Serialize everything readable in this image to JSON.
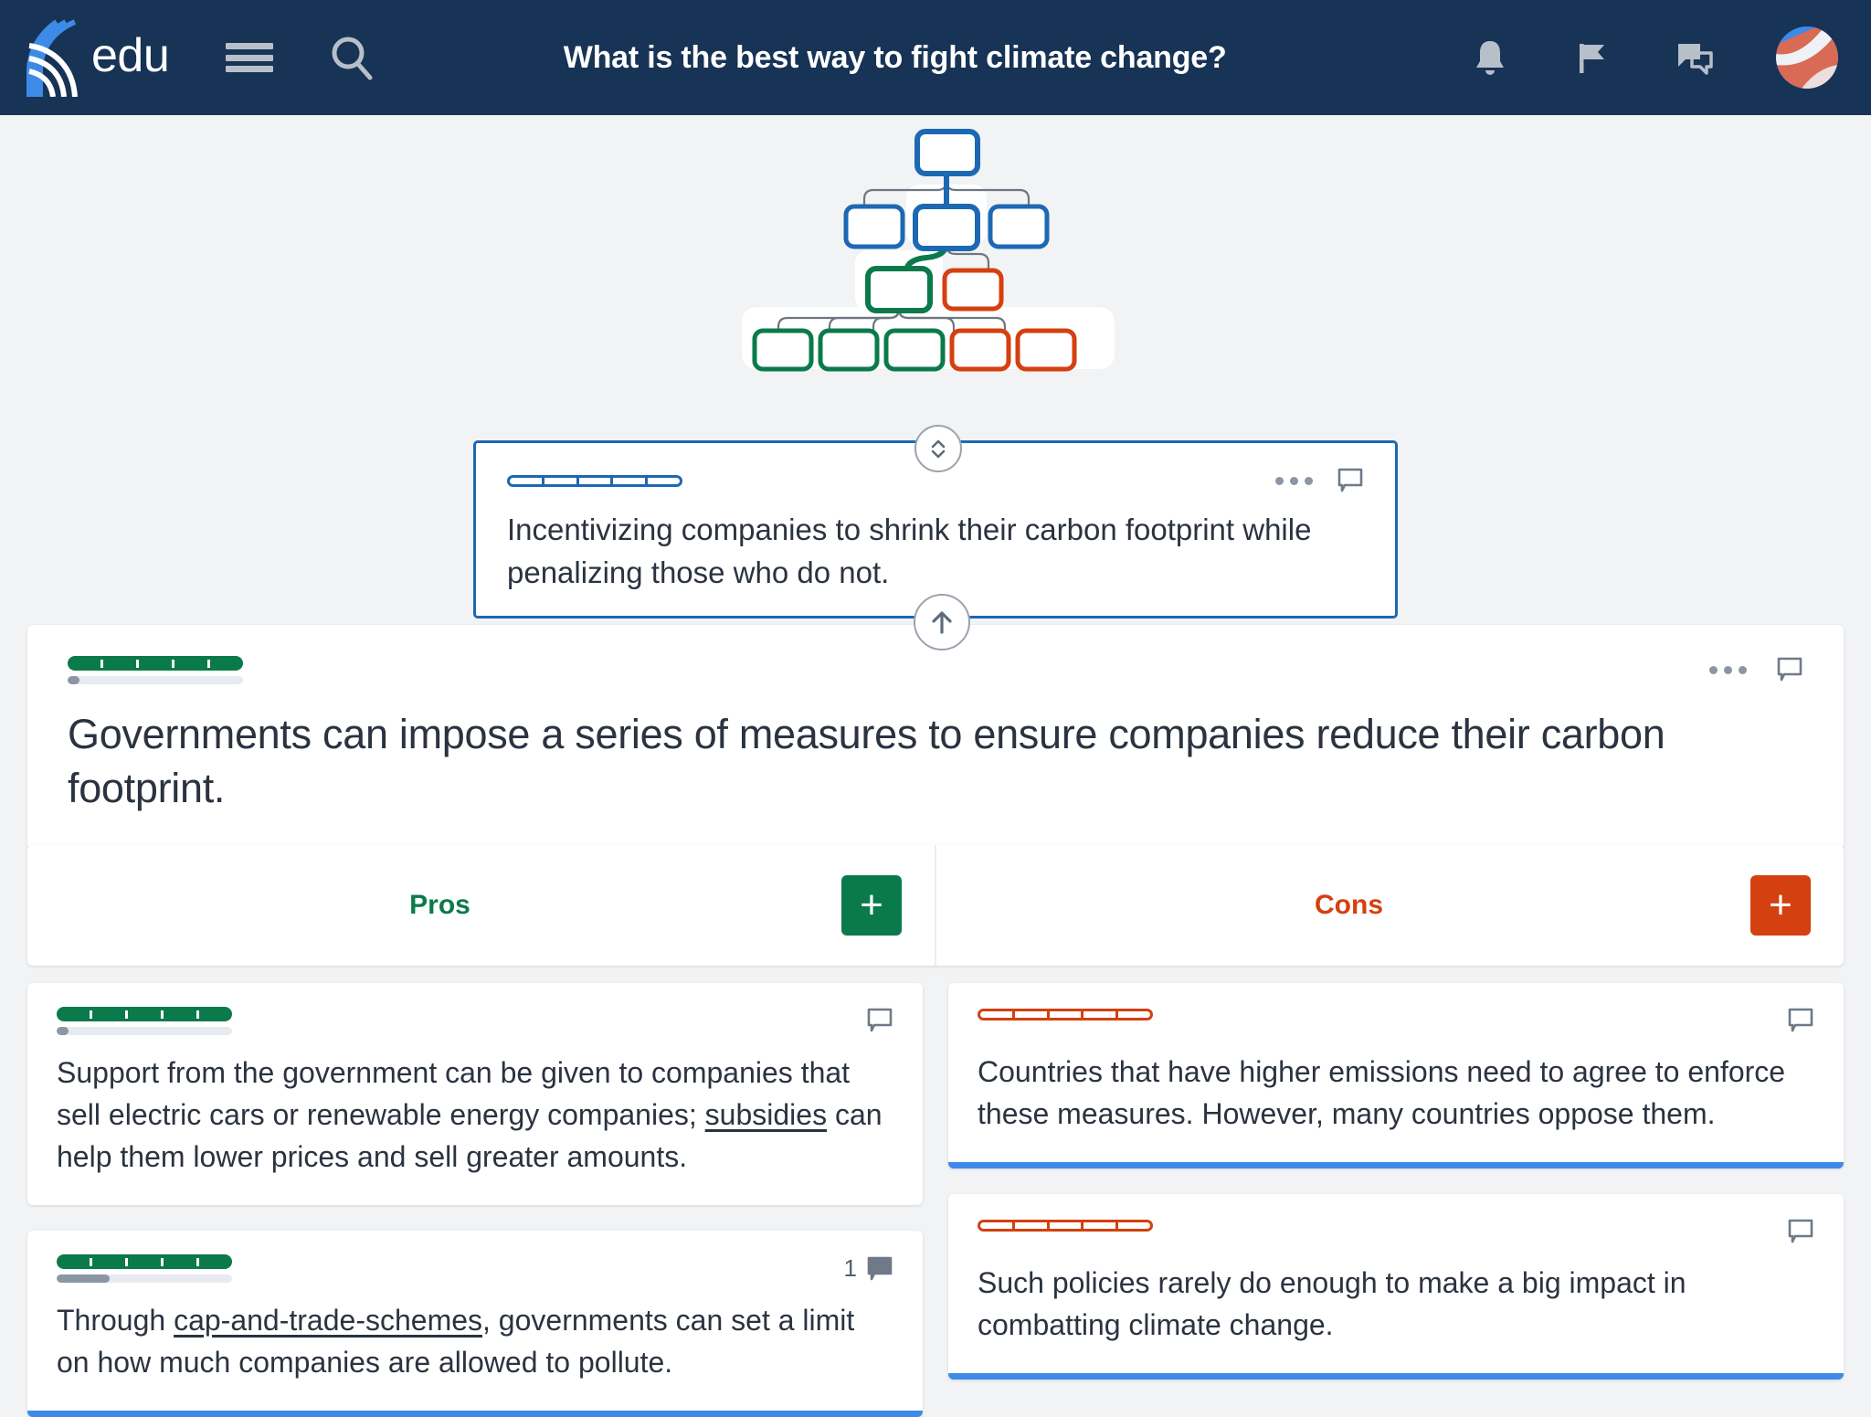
{
  "header": {
    "brand_text": "edu",
    "logo_icon": "kialo-arcs-logo",
    "menu_icon": "hamburger-menu-icon",
    "search_icon": "search-icon",
    "title": "What is the best way to fight climate change?",
    "notifications_icon": "bell-icon",
    "flag_icon": "flag-icon",
    "messages_icon": "chat-bubbles-icon",
    "avatar_icon": "user-avatar",
    "bg_color": "#173355"
  },
  "minimap": {
    "icon": "argument-tree-minimap",
    "nodes": [
      {
        "id": "root",
        "color": "#1d68b3",
        "level": 0,
        "selected": false
      },
      {
        "id": "l1a",
        "color": "#1d68b3",
        "level": 1,
        "selected": false
      },
      {
        "id": "l1b",
        "color": "#1d68b3",
        "level": 1,
        "selected": true
      },
      {
        "id": "l1c",
        "color": "#1d68b3",
        "level": 1,
        "selected": false
      },
      {
        "id": "l2a",
        "color": "#0b7a4b",
        "level": 2,
        "selected": true
      },
      {
        "id": "l2b",
        "color": "#d4400f",
        "level": 2,
        "selected": false
      },
      {
        "id": "l3a",
        "color": "#0b7a4b",
        "level": 3,
        "selected": false
      },
      {
        "id": "l3b",
        "color": "#0b7a4b",
        "level": 3,
        "selected": false
      },
      {
        "id": "l3c",
        "color": "#0b7a4b",
        "level": 3,
        "selected": false
      },
      {
        "id": "l3d",
        "color": "#d4400f",
        "level": 3,
        "selected": false
      },
      {
        "id": "l3e",
        "color": "#d4400f",
        "level": 3,
        "selected": false
      }
    ]
  },
  "parent_card": {
    "text": "Incentivizing companies to shrink their carbon footprint while penalizing those who do not.",
    "impact_bar": {
      "style": "outline",
      "segments": 5,
      "filled": 0,
      "color": "#1d68b3"
    },
    "more_icon": "more-options-icon",
    "comment_icon": "comment-icon",
    "border_color": "#1d68b3"
  },
  "controls": {
    "collapse_toggle_icon": "chevron-up-down-icon",
    "navigate_up_icon": "arrow-up-icon"
  },
  "claim_card": {
    "text": "Governments can impose a series of measures to ensure companies reduce their carbon footprint.",
    "impact_bar": {
      "style": "filled",
      "segments": 5,
      "color": "#0b7a4b"
    },
    "secondary_bar": {
      "fill_percent": 7,
      "fill_color": "#8b96a5",
      "track_color": "#e7eaee"
    },
    "more_icon": "more-options-icon",
    "comment_icon": "comment-icon"
  },
  "columns": {
    "pros": {
      "label": "Pros",
      "color": "#0b7a4b",
      "add_label": "+",
      "add_icon": "plus-icon",
      "cards": [
        {
          "text_before": "Support from the government can be given to companies that sell electric cars or renewable energy companies; ",
          "link_text": "subsidies",
          "text_after": " can help them lower prices and sell greater amounts.",
          "impact_bar": {
            "style": "filled",
            "segments": 5,
            "color": "#0b7a4b"
          },
          "secondary_bar": {
            "fill_percent": 7
          },
          "comment_icon": "comment-icon",
          "comment_count": "",
          "accent_bottom": false
        },
        {
          "text_before": "Through ",
          "link_text": "cap-and-trade-schemes",
          "text_after": ", governments can set a limit on how much companies are allowed to pollute.",
          "impact_bar": {
            "style": "filled",
            "segments": 5,
            "color": "#0b7a4b"
          },
          "secondary_bar": {
            "fill_percent": 30
          },
          "comment_icon": "comment-icon-filled",
          "comment_count": "1",
          "accent_bottom": true
        }
      ]
    },
    "cons": {
      "label": "Cons",
      "color": "#d4400f",
      "add_label": "+",
      "add_icon": "plus-icon",
      "cards": [
        {
          "text_before": "Countries that have higher emissions need to agree to enforce these measures. However, many countries oppose them.",
          "link_text": "",
          "text_after": "",
          "impact_bar": {
            "style": "outline",
            "segments": 5,
            "color": "#d4400f"
          },
          "comment_icon": "comment-icon",
          "comment_count": "",
          "accent_bottom": true
        },
        {
          "text_before": "Such policies rarely do enough to make a big impact in combatting climate change.",
          "link_text": "",
          "text_after": "",
          "impact_bar": {
            "style": "outline",
            "segments": 5,
            "color": "#d4400f"
          },
          "comment_icon": "comment-icon",
          "comment_count": "",
          "accent_bottom": true
        }
      ]
    }
  },
  "theme": {
    "page_bg": "#f1f3f5",
    "card_bg": "#ffffff",
    "text": "#2b3340",
    "blue": "#1d68b3",
    "accent_blue": "#3d8ae8",
    "green": "#0b7a4b",
    "red": "#d4400f",
    "muted": "#8b96a5"
  }
}
